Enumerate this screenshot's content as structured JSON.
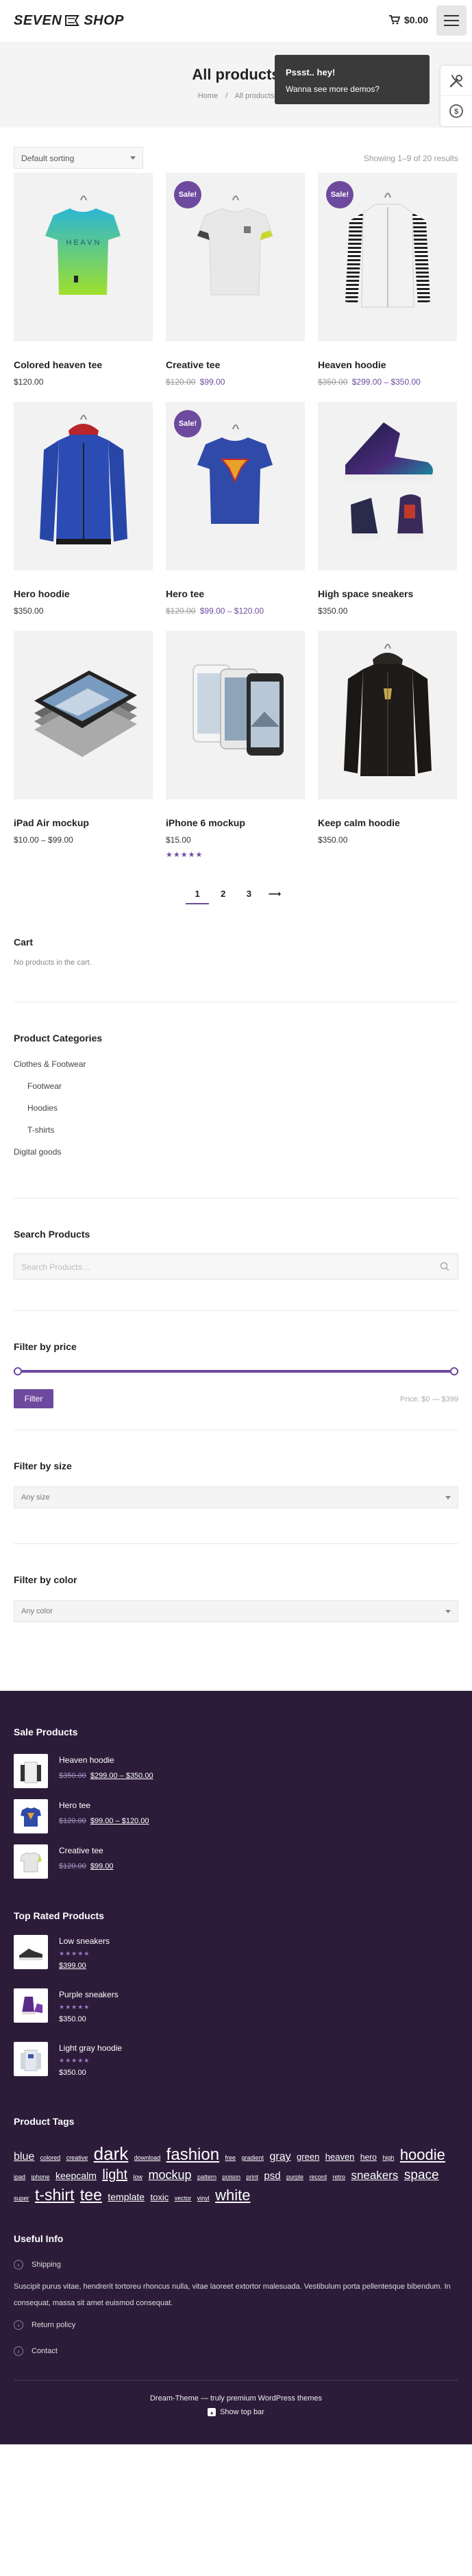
{
  "header": {
    "logo_text_1": "SEVEN",
    "logo_text_2": "SHOP",
    "cart_total": "$0.00"
  },
  "title_bar": {
    "title": "All products",
    "breadcrumb_home": "Home",
    "breadcrumb_sep": "/",
    "breadcrumb_current": "All products"
  },
  "popup": {
    "title": "Pssst.. hey!",
    "text": "Wanna see more demos?"
  },
  "toolbar": {
    "sort_value": "Default sorting",
    "results_count": "Showing 1–9 of 20 results"
  },
  "products": [
    {
      "name": "Colored heaven tee",
      "price": "$120.00",
      "sale": false,
      "badge": ""
    },
    {
      "name": "Creative tee",
      "old_price": "$120.00",
      "new_price": "$99.00",
      "sale": true,
      "badge": "Sale!"
    },
    {
      "name": "Heaven hoodie",
      "old_price": "$350.00",
      "new_price": "$299.00 – $350.00",
      "sale": true,
      "badge": "Sale!"
    },
    {
      "name": "Hero hoodie",
      "price": "$350.00",
      "sale": false,
      "badge": ""
    },
    {
      "name": "Hero tee",
      "old_price": "$120.00",
      "new_price": "$99.00 – $120.00",
      "sale": true,
      "badge": "Sale!"
    },
    {
      "name": "High space sneakers",
      "price": "$350.00",
      "sale": false,
      "badge": ""
    },
    {
      "name": "iPad Air mockup",
      "price": "$10.00 – $99.00",
      "sale": false,
      "badge": ""
    },
    {
      "name": "iPhone 6 mockup",
      "price": "$15.00",
      "sale": false,
      "badge": "",
      "stars": "★★★★★"
    },
    {
      "name": "Keep calm hoodie",
      "price": "$350.00",
      "sale": false,
      "badge": ""
    }
  ],
  "pagination": {
    "pages": [
      "1",
      "2",
      "3"
    ],
    "next": "⟶"
  },
  "widgets": {
    "cart": {
      "title": "Cart",
      "empty_text": "No products in the cart."
    },
    "categories": {
      "title": "Product Categories",
      "items": [
        "Clothes & Footwear",
        "Footwear",
        "Hoodies",
        "T-shirts",
        "Digital goods"
      ]
    },
    "search": {
      "title": "Search Products",
      "placeholder": "Search Products…"
    },
    "price": {
      "title": "Filter by price",
      "button": "Filter",
      "range": "Price: $0 — $399"
    },
    "size": {
      "title": "Filter by size",
      "value": "Any size"
    },
    "color": {
      "title": "Filter by color",
      "value": "Any color"
    }
  },
  "footer": {
    "sale_products": {
      "title": "Sale Products",
      "items": [
        {
          "name": "Heaven hoodie",
          "old_price": "$350.00",
          "new_price": "$299.00 – $350.00"
        },
        {
          "name": "Hero tee",
          "old_price": "$120.00",
          "new_price": "$99.00 – $120.00"
        },
        {
          "name": "Creative tee",
          "old_price": "$120.00",
          "new_price": "$99.00"
        }
      ]
    },
    "top_rated": {
      "title": "Top Rated Products",
      "items": [
        {
          "name": "Low sneakers",
          "stars": "★★★★★",
          "old_price": "",
          "price": "$399.00"
        },
        {
          "name": "Purple sneakers",
          "stars": "★★★★★",
          "price": "$350.00"
        },
        {
          "name": "Light gray hoodie",
          "stars": "★★★★★",
          "price": "$350.00"
        }
      ]
    },
    "tags": {
      "title": "Product Tags",
      "list": [
        {
          "t": "blue",
          "s": 16
        },
        {
          "t": "colored",
          "s": 9
        },
        {
          "t": "creative",
          "s": 9
        },
        {
          "t": "dark",
          "s": 26
        },
        {
          "t": "download",
          "s": 9
        },
        {
          "t": "fashion",
          "s": 24
        },
        {
          "t": "free",
          "s": 9
        },
        {
          "t": "gradient",
          "s": 9
        },
        {
          "t": "gray",
          "s": 16
        },
        {
          "t": "green",
          "s": 13
        },
        {
          "t": "heaven",
          "s": 13
        },
        {
          "t": "hero",
          "s": 12
        },
        {
          "t": "high",
          "s": 9
        },
        {
          "t": "hoodie",
          "s": 22
        },
        {
          "t": "ipad",
          "s": 9
        },
        {
          "t": "iphone",
          "s": 9
        },
        {
          "t": "keepcalm",
          "s": 14
        },
        {
          "t": "light",
          "s": 20
        },
        {
          "t": "low",
          "s": 9
        },
        {
          "t": "mockup",
          "s": 18
        },
        {
          "t": "pattern",
          "s": 9
        },
        {
          "t": "poison",
          "s": 9
        },
        {
          "t": "print",
          "s": 9
        },
        {
          "t": "psd",
          "s": 15
        },
        {
          "t": "purple",
          "s": 9
        },
        {
          "t": "record",
          "s": 9
        },
        {
          "t": "retro",
          "s": 9
        },
        {
          "t": "sneakers",
          "s": 17
        },
        {
          "t": "space",
          "s": 19
        },
        {
          "t": "super",
          "s": 9
        },
        {
          "t": "t-shirt",
          "s": 23
        },
        {
          "t": "tee",
          "s": 23
        },
        {
          "t": "template",
          "s": 14
        },
        {
          "t": "toxic",
          "s": 13
        },
        {
          "t": "vector",
          "s": 9
        },
        {
          "t": "vinyl",
          "s": 9
        },
        {
          "t": "white",
          "s": 22
        }
      ]
    },
    "useful_info": {
      "title": "Useful Info",
      "shipping": "Shipping",
      "paragraph": "Suscipit purus vitae, hendrerit tortoreu rhoncus nulla, vitae laoreet extortor malesuada. Vestibulum porta pellentesque bibendum. In consequat, massa sit amet euismod consequat.",
      "return_policy": "Return policy",
      "contact": "Contact"
    },
    "bottom": {
      "credit": "Dream-Theme — truly premium WordPress themes",
      "top_bar": "Show top bar"
    }
  }
}
